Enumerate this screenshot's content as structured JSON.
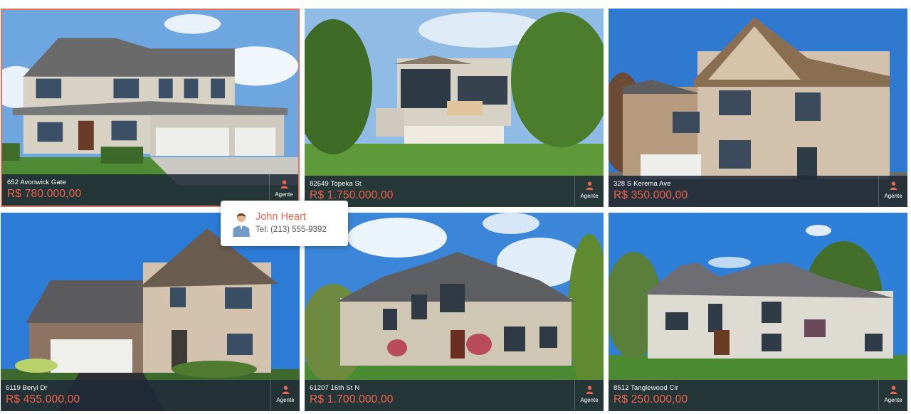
{
  "listings": [
    {
      "address": "652 Avonwick Gate",
      "price": "R$ 780.000,00",
      "agent_label": "Agente"
    },
    {
      "address": "82649 Topeka St",
      "price": "R$ 1.750.000,00",
      "agent_label": "Agente"
    },
    {
      "address": "328 S Kerema Ave",
      "price": "R$ 350.000,00",
      "agent_label": "Agente"
    },
    {
      "address": "5119 Beryl Dr",
      "price": "R$ 455.000,00",
      "agent_label": "Agente"
    },
    {
      "address": "61207 16th St N",
      "price": "R$ 1.700.000,00",
      "agent_label": "Agente"
    },
    {
      "address": "8512 Tanglewood Cir",
      "price": "R$ 250.000,00",
      "agent_label": "Agente"
    }
  ],
  "agent_tooltip": {
    "name": "John Heart",
    "phone": "Tel: (213) 555-9392"
  },
  "colors": {
    "accent": "#f0624a",
    "selection_border": "#e8735c",
    "info_bar": "#1f2a38"
  },
  "icons": {
    "agent": "person-icon",
    "tooltip_avatar": "agent-avatar"
  }
}
